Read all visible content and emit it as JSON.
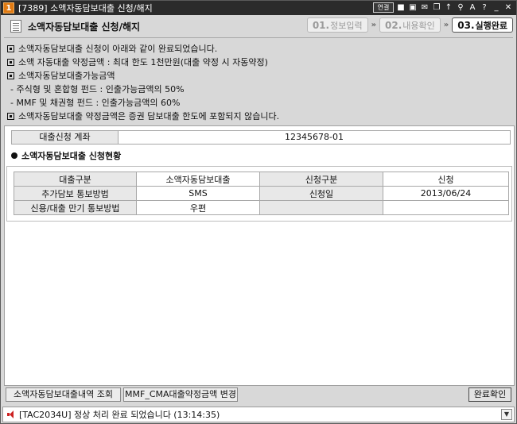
{
  "window": {
    "number": "1",
    "title": "[7389] 소액자동담보대출 신청/해지",
    "icons": [
      "연결",
      "lock-icon",
      "monitor-icon",
      "mail-icon",
      "copy-icon",
      "pin-icon",
      "zoom-icon",
      "font-size-icon",
      "help-icon",
      "minimize-icon",
      "close-icon"
    ]
  },
  "header": {
    "title": "소액자동담보대출 신청/해지",
    "steps": [
      {
        "num": "01.",
        "label": "정보입력"
      },
      {
        "num": "02.",
        "label": "내용확인"
      },
      {
        "num": "03.",
        "label": "실행완료"
      }
    ]
  },
  "notices": [
    "소액자동담보대출 신청이 아래와 같이 완료되었습니다.",
    "소액 자동대출 약정금액 : 최대 한도 1천만원(대출 약정 시 자동약정)",
    "소액자동담보대출가능금액",
    "소액자동담보대출 약정금액은 증권 담보대출 한도에 포함되지 않습니다."
  ],
  "subnotes": [
    "- 주식형 및 혼합형 펀드 : 인출가능금액의 50%",
    "- MMF 및 채권형 펀드 : 인출가능금액의 60%"
  ],
  "account": {
    "label": "대출신청 계좌",
    "value": "12345678-01"
  },
  "status_section": {
    "title": "소액자동담보대출 신청현황",
    "rows": [
      [
        "대출구분",
        "소액자동담보대출",
        "신청구분",
        "신청"
      ],
      [
        "추가담보 통보방법",
        "SMS",
        "신청일",
        "2013/06/24"
      ],
      [
        "신용/대출 만기 통보방법",
        "우편",
        "",
        ""
      ]
    ]
  },
  "buttons": {
    "history": "소액자동담보대출내역 조회",
    "change": "MMF_CMA대출약정금액 변경",
    "confirm": "완료확인"
  },
  "statusbar": {
    "message": "[TAC2034U] 정상 처리 완료 되었습니다 (13:14:35)"
  }
}
